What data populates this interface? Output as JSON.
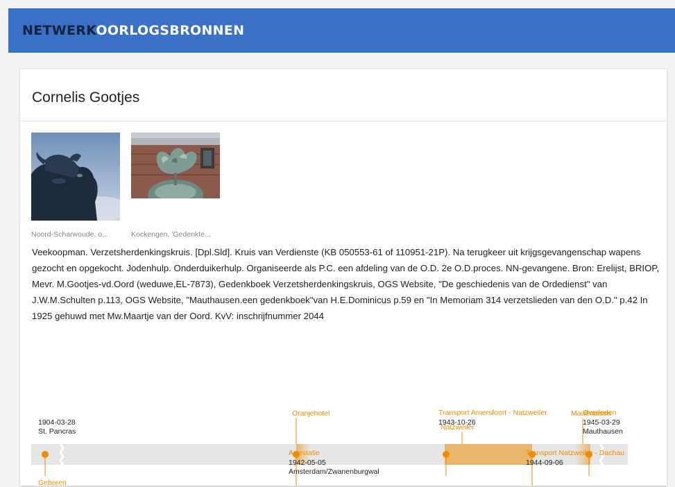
{
  "header": {
    "logo_part1": "NETWERK",
    "logo_part2": "OORLOGSBRONNEN",
    "bg_color": "#3a70c6"
  },
  "person": {
    "name": "Cornelis Gootjes"
  },
  "images": [
    {
      "caption": "Noord-Scharwoude, o..."
    },
    {
      "caption": "Kockengen, 'Gedenkte..."
    }
  ],
  "bio": "Veekoopman. Verzetsherdenkingskruis. [Dpl.Sld]. Kruis van Verdienste (KB 050553-61 of 110951-21P). Na terugkeer uit krijgsgevangenschap wapens gezocht en opgekocht. Jodenhulp. Onderduikerhulp. Organiseerde als P.C. een afdeling van de O.D. 2e O.D.proces. NN-gevangene. Bron: Erelijst, BRIOP, Mevr. M.Gootjes-vd.Oord (weduwe,EL-7873), Gedenkboek Verzetsherdenkingskruis, OGS Website, \"De geschiedenis van de Ordedienst\" van J.W.M.Schulten p.113, OGS Website, \"Mauthausen.een gedenkboek\"van H.E.Dominicus p.59 en \"In Memoriam 314 verzetslieden van den O.D.\" p.42 In 1925 gehuwd met Mw.Maartje van der Oord. KvV: inschrijfnummer 2044",
  "timeline": {
    "accent_color": "#f08c00",
    "periods": [
      {
        "label": "Oranjehotel"
      },
      {
        "label": "Natzweiler"
      },
      {
        "label": "Mauthausen"
      }
    ],
    "events": [
      {
        "title": "Geboren",
        "date": "1904-03-28",
        "place": "St. Pancras"
      },
      {
        "title": "Arrestatie",
        "date": "1942-05-05",
        "place": "Amsterdam/Zwanenburgwal"
      },
      {
        "title": "Transport Amersfoort - Natzweiler",
        "date": "1943-10-26",
        "place": ""
      },
      {
        "title": "Transport Natzweiler - Dachau",
        "date": "1944-09-06",
        "place": ""
      },
      {
        "title": "Overleden",
        "date": "1945-03-29",
        "place": "Mauthausen"
      }
    ]
  }
}
